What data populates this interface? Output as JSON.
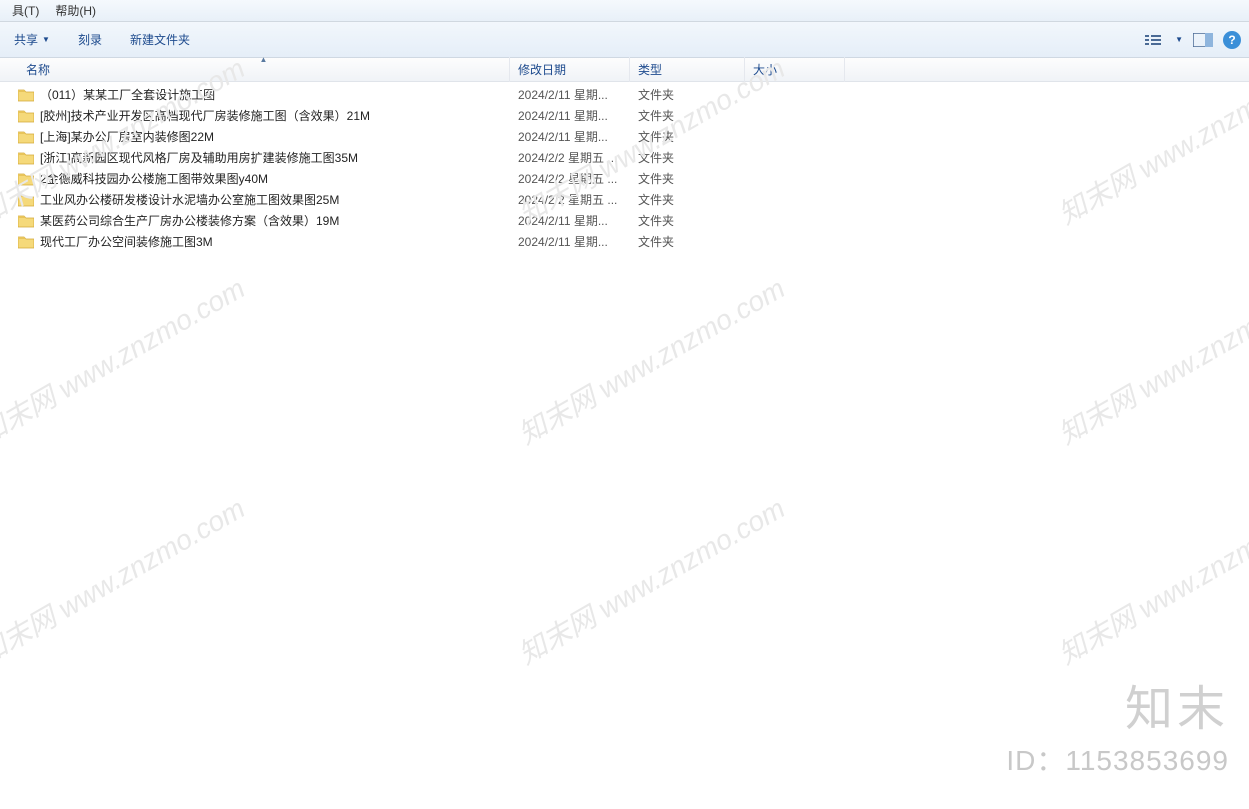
{
  "menubar": {
    "tools": "具(T)",
    "help": "帮助(H)"
  },
  "toolbar": {
    "share": "共享",
    "burn": "刻录",
    "new_folder": "新建文件夹"
  },
  "columns": {
    "name": "名称",
    "date": "修改日期",
    "type": "类型",
    "size": "大小"
  },
  "files": [
    {
      "name": "（011）某某工厂全套设计施工图",
      "date": "2024/2/11 星期...",
      "type": "文件夹",
      "size": ""
    },
    {
      "name": "[胶州]技术产业开发区高档现代厂房装修施工图（含效果）21M",
      "date": "2024/2/11 星期...",
      "type": "文件夹",
      "size": ""
    },
    {
      "name": "[上海]某办公厂房室内装修图22M",
      "date": "2024/2/11 星期...",
      "type": "文件夹",
      "size": ""
    },
    {
      "name": "[浙江]高新园区现代风格厂房及辅助用房扩建装修施工图35M",
      "date": "2024/2/2 星期五 ...",
      "type": "文件夹",
      "size": ""
    },
    {
      "name": "2金德威科技园办公楼施工图带效果图y40M",
      "date": "2024/2/2 星期五 ...",
      "type": "文件夹",
      "size": ""
    },
    {
      "name": "工业风办公楼研发楼设计水泥墙办公室施工图效果图25M",
      "date": "2024/2/2 星期五 ...",
      "type": "文件夹",
      "size": ""
    },
    {
      "name": "某医药公司综合生产厂房办公楼装修方案（含效果）19M",
      "date": "2024/2/11 星期...",
      "type": "文件夹",
      "size": ""
    },
    {
      "name": "现代工厂办公空间装修施工图3M",
      "date": "2024/2/11 星期...",
      "type": "文件夹",
      "size": ""
    }
  ],
  "watermark_text": "知末网 www.znzmo.com",
  "brand": {
    "text": "知末",
    "id": "ID：1153853699"
  }
}
